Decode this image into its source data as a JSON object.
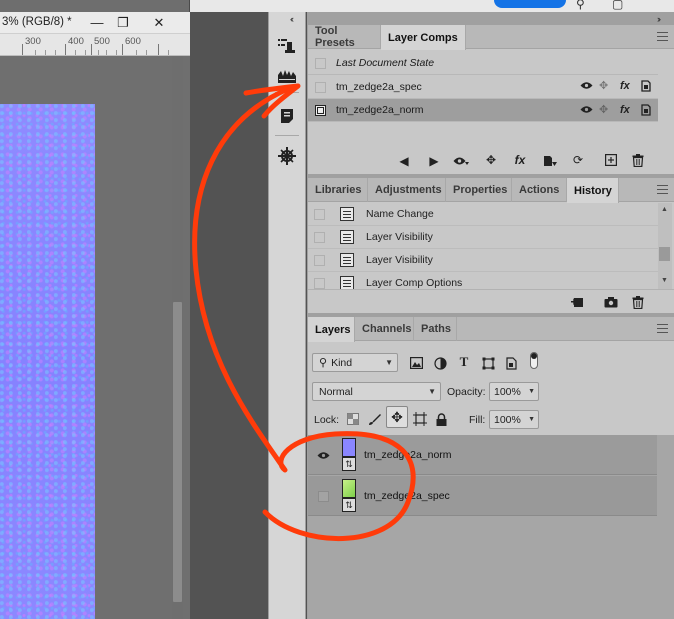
{
  "document": {
    "title": "3% (RGB/8) *",
    "ruler_numbers": [
      "300",
      "400",
      "500",
      "600"
    ]
  },
  "window_controls": {
    "minimize": "—",
    "restore": "❐",
    "close": "✕"
  },
  "dock": {
    "collapse": "‹‹",
    "items": [
      "tool-presets-icon",
      "layer-comps-icon",
      "notes-icon",
      "navigator-icon"
    ]
  },
  "panels": {
    "collapse": "››"
  },
  "layer_comps_panel": {
    "tabs": [
      "Tool Presets",
      "Layer Comps"
    ],
    "active_tab": "Layer Comps",
    "comps": [
      {
        "label": "Last Document State"
      },
      {
        "label": "tm_zedge2a_spec"
      },
      {
        "label": "tm_zedge2a_norm"
      }
    ]
  },
  "history_panel": {
    "tabs": [
      "Libraries",
      "Adjustments",
      "Properties",
      "Actions",
      "History"
    ],
    "active_tab": "History",
    "items": [
      {
        "label": "Name Change"
      },
      {
        "label": "Layer Visibility"
      },
      {
        "label": "Layer Visibility"
      },
      {
        "label": "Layer Comp Options"
      }
    ]
  },
  "layers_panel": {
    "tabs": [
      "Layers",
      "Channels",
      "Paths"
    ],
    "active_tab": "Layers",
    "filter_kind": "Kind",
    "blend_mode": "Normal",
    "opacity_label": "Opacity:",
    "opacity_value": "100%",
    "lock_label": "Lock:",
    "fill_label": "Fill:",
    "fill_value": "100%",
    "layers": [
      {
        "name": "tm_zedge2a_norm",
        "visible": true,
        "thumb_color": "#8a86ff"
      },
      {
        "name": "tm_zedge2a_spec",
        "visible": false,
        "thumb_color": "#9fe05a"
      }
    ]
  },
  "colors": {
    "annotation": "#ff3b0a",
    "normal_map": "#8a86ff",
    "panel_bg": "#c8c8c8",
    "accent": "#1473e6"
  }
}
